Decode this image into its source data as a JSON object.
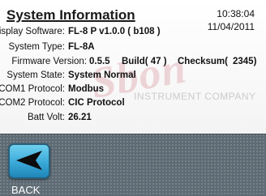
{
  "screen": {
    "title": "System Information",
    "time": "10:38:04",
    "date": "11/04/2011"
  },
  "watermark": {
    "logo_text": "Sbon",
    "sub_text": "INSTRUMENT COMPANY"
  },
  "info": {
    "display_software_label": "Display Software:",
    "display_software_value": "FL-8 P v1.0.0 ( b108 )",
    "system_type_label": "System Type:",
    "system_type_value": "FL-8A",
    "firmware_label": "Firmware Version:",
    "firmware_value": "0.5.5",
    "firmware_build": "Build( 47 )",
    "firmware_checksum_label": "Checksum(",
    "firmware_checksum_value": "2345)",
    "system_state_label": "System State:",
    "system_state_value": "System Normal",
    "com1_label": "COM1 Protocol:",
    "com1_value": "Modbus",
    "com2_label": "COM2 Protocol:",
    "com2_value": "CIC Protocol",
    "batt_label": "Batt Volt:",
    "batt_value": "26.21"
  },
  "nav": {
    "back_label": "BACK",
    "back_icon": "left-arrow-icon"
  },
  "colors": {
    "nav_bar": "#5e6b74",
    "button_blue": "#3aa9d8",
    "watermark": "#b92d3c"
  }
}
